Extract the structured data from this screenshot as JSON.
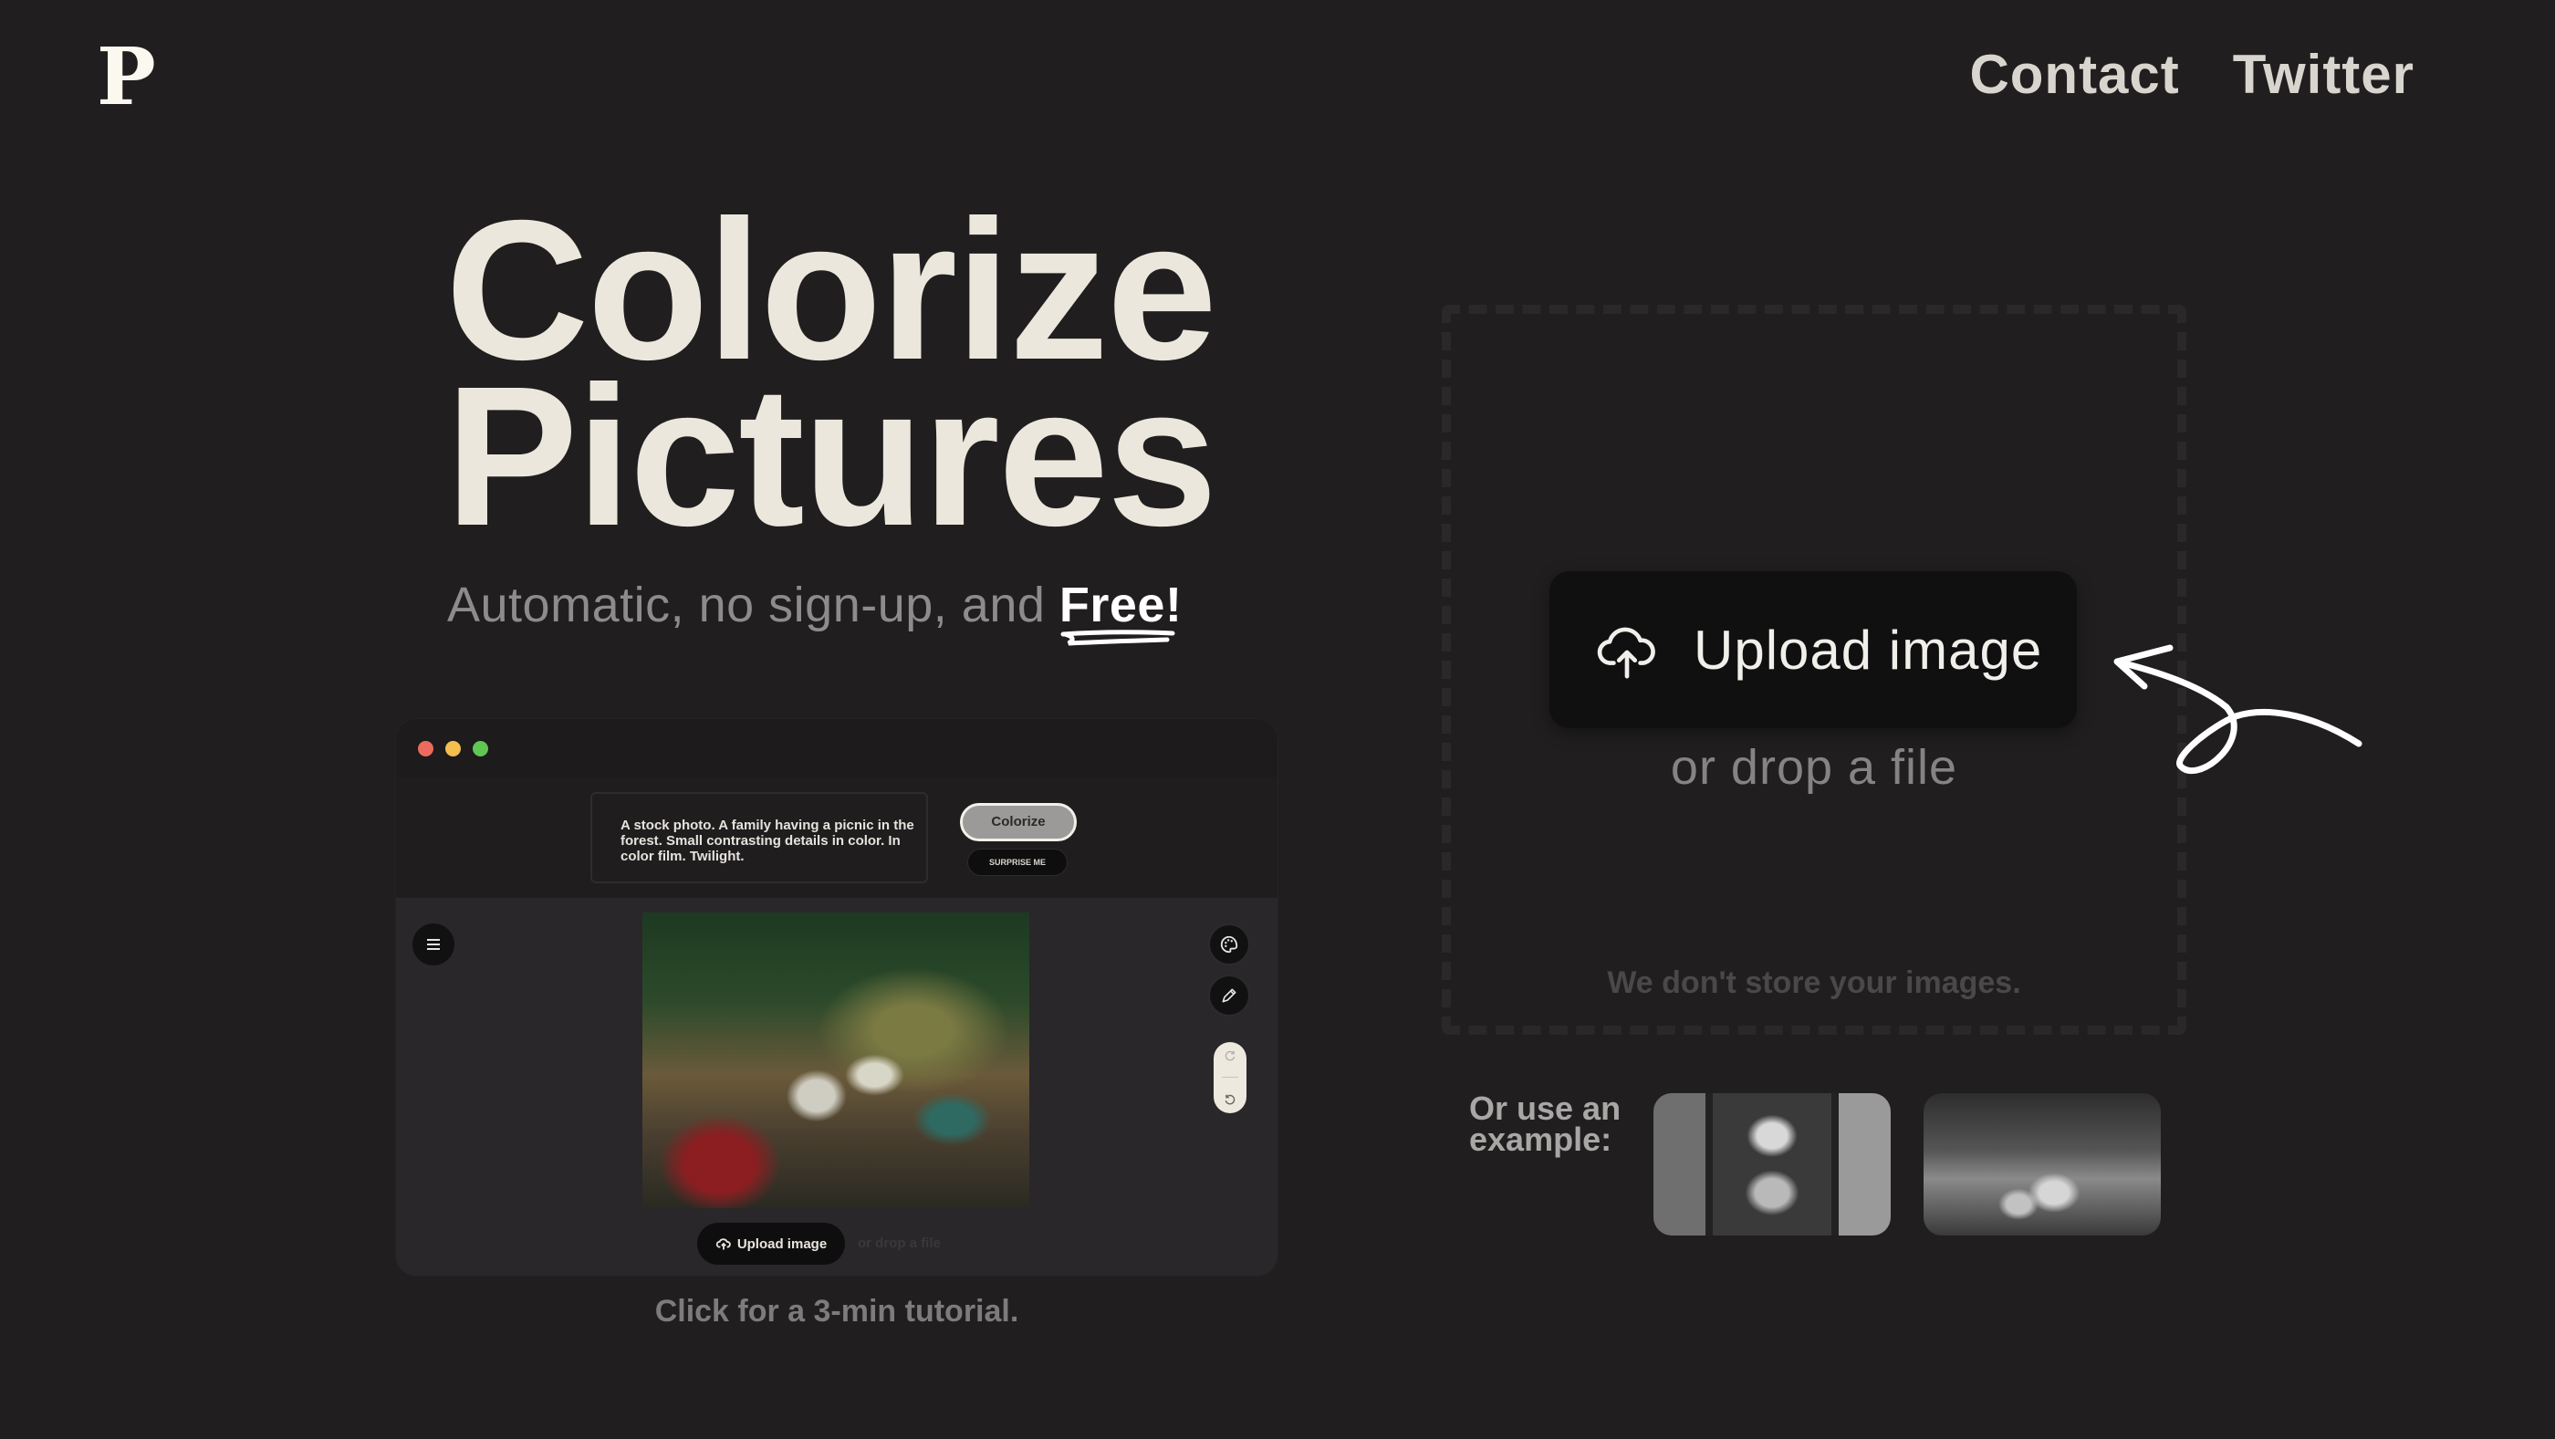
{
  "header": {
    "logo": "P",
    "nav": [
      {
        "label": "Contact"
      },
      {
        "label": "Twitter"
      }
    ]
  },
  "hero": {
    "title_line1": "Colorize",
    "title_line2": "Pictures",
    "subtitle_prefix": "Automatic, no sign-up, and ",
    "subtitle_emphasis": "Free!"
  },
  "tutorial_preview": {
    "window_dots": [
      "#ed6a5e",
      "#f4bf4f",
      "#61c554"
    ],
    "prompt_text": "A stock photo. A family having a picnic in the forest. Small contrasting details in color. In color film. Twilight.",
    "colorize_label": "Colorize",
    "surprise_label": "SURPRISE ME",
    "menu_icon": "hamburger-menu-icon",
    "tools": [
      "palette-icon",
      "pencil-icon",
      "redo-icon",
      "undo-icon"
    ],
    "upload_label": "Upload image",
    "drop_label": "or drop a file",
    "caption": "Click for a 3-min tutorial."
  },
  "upload": {
    "icon": "cloud-upload-icon",
    "button_label": "Upload image",
    "drop_label": "or drop a file",
    "privacy_note": "We don't store your images."
  },
  "examples": {
    "label": "Or use an example:",
    "items": [
      {
        "name": "example-portrait-bw"
      },
      {
        "name": "example-family-picnic-bw"
      }
    ]
  }
}
